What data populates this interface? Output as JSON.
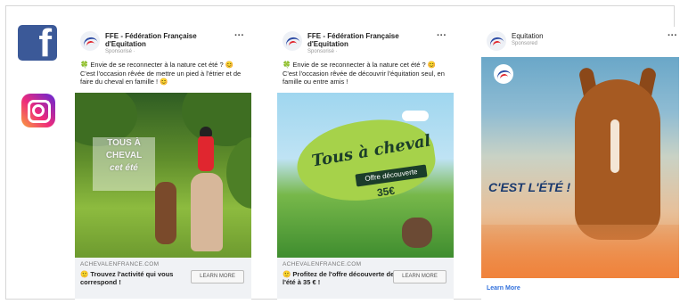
{
  "social": {
    "facebook_letter": "f",
    "facebook_color": "#3b5998",
    "instagram_colors": [
      "#f9a03c",
      "#ee2a7b",
      "#6228d7"
    ]
  },
  "ads": [
    {
      "page_name": "FFE - Fédération Française d'Equitation",
      "sponsored": "Sponsorisé · ",
      "post_text": "🍀 Envie de se reconnecter à la nature cet été ? 😊 C'est l'occasion rêvée de mettre un pied à l'étrier et de faire du cheval en famille ! 😊",
      "overlay_lines": [
        "TOUS À",
        "CHEVAL",
        "cet été"
      ],
      "domain": "ACHEVALENFRANCE.COM",
      "cta_text": "🙂 Trouvez l'activité qui vous correspond !",
      "button": "LEARN MORE"
    },
    {
      "page_name": "FFE - Fédération Française d'Equitation",
      "sponsored": "Sponsorisé · ",
      "post_text": "🍀 Envie de se reconnecter à la nature cet été ? 😊 C'est l'occasion rêvée de découvrir l'équitation seul, en famille ou entre amis !",
      "headline": "Tous à cheval",
      "offer": "Offre découverte",
      "price": "35€",
      "domain": "ACHEVALENFRANCE.COM",
      "cta_text": "🙂 Profitez de l'offre découverte de l'été à 35 € !",
      "button": "LEARN MORE"
    },
    {
      "page_name": "Equitation",
      "sponsored": "Sponsored",
      "headline": "C'EST L'ÉTÉ !",
      "link": "Learn More"
    }
  ],
  "more_icon": "···"
}
